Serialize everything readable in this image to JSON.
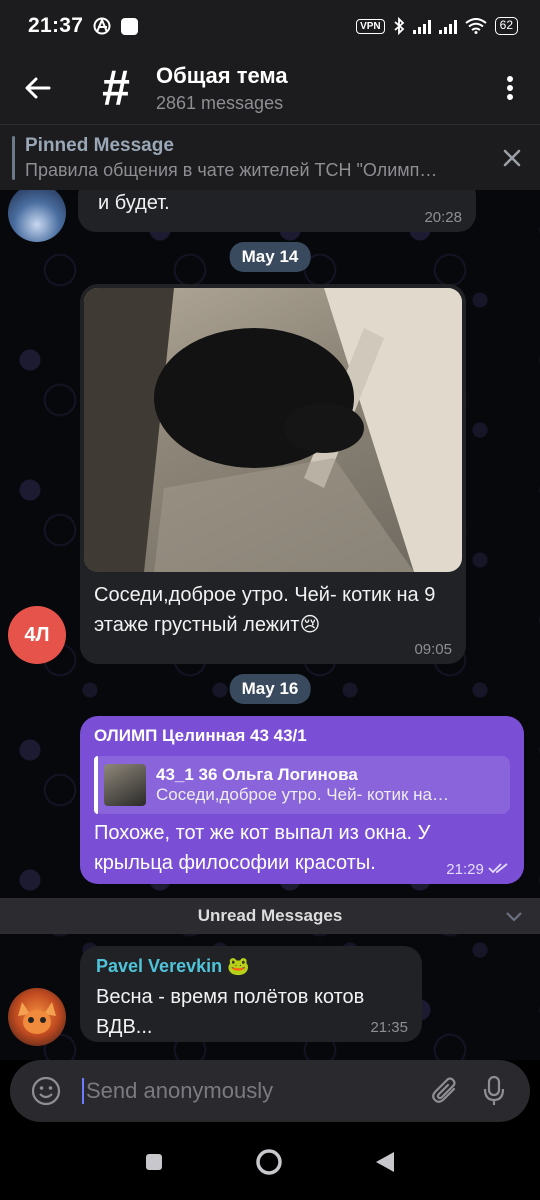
{
  "status_bar": {
    "time": "21:37",
    "vpn": "VPN",
    "battery": "62"
  },
  "header": {
    "icon": "hash-icon",
    "title": "Общая тема",
    "subtitle": "2861 messages"
  },
  "pinned": {
    "label": "Pinned Message",
    "text": "Правила общения в чате жителей ТСН \"Олимп…"
  },
  "messages": [
    {
      "text": "и будет.",
      "time": "20:28"
    },
    {
      "date": "May 14"
    },
    {
      "avatar_initials": "4Л",
      "avatar_color": "#e5534b",
      "text": "Соседи,доброе утро. Чей- котик на 9 этаже грустный лежит😢",
      "time": "09:05"
    },
    {
      "date": "May 16"
    },
    {
      "sender": "ОЛИМП Целинная 43 43/1",
      "reply_name": "43_1 36 Ольга Логинова",
      "reply_text": "Соседи,доброе утро. Чей- котик на…",
      "text": "Похоже, тот же кот выпал из окна. У крыльца философии красоты.",
      "time": "21:29",
      "bubble_color": "#7a4fd6"
    },
    {
      "separator": "Unread Messages"
    },
    {
      "sender": "Pavel Verevkin",
      "sender_emoji": "🐸",
      "sender_color": "#4fc3d9",
      "text": "Весна - время полётов котов ВДВ...",
      "time": "21:35"
    }
  ],
  "composer": {
    "placeholder": "Send anonymously"
  }
}
